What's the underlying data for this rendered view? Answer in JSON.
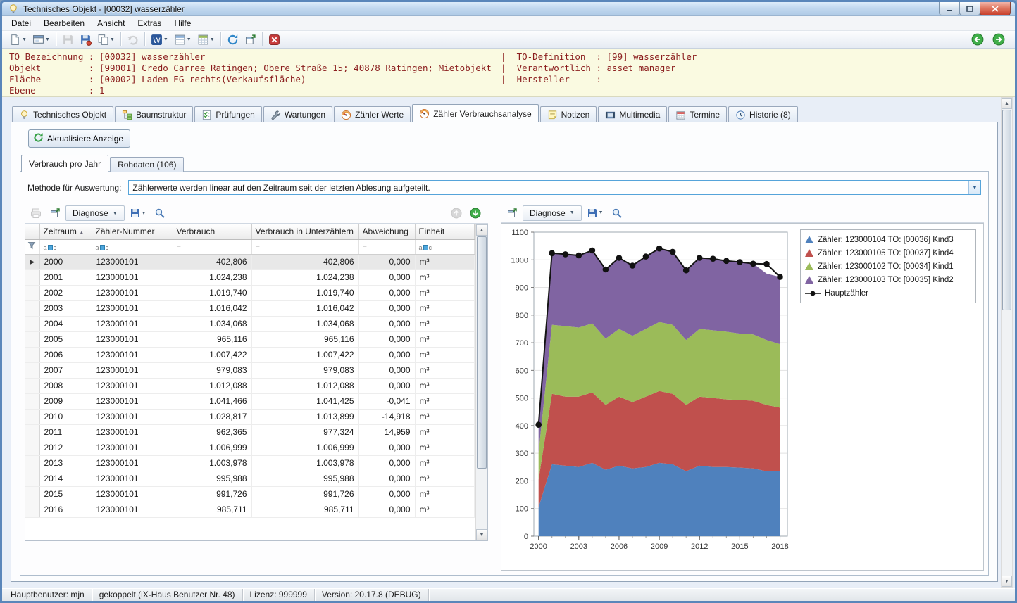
{
  "window": {
    "title": "Technisches Objekt - [00032] wasserzähler"
  },
  "menu": {
    "items": [
      "Datei",
      "Bearbeiten",
      "Ansicht",
      "Extras",
      "Hilfe"
    ]
  },
  "info_panel": {
    "lines": [
      {
        "left": "TO Bezeichnung : [00032] wasserzähler",
        "right": "|  TO-Definition  : [99] wasserzähler"
      },
      {
        "left": "Objekt         : [99001] Credo Carree Ratingen; Obere Straße 15; 40878 Ratingen; Mietobjekt",
        "right": "|  Verantwortlich : asset manager"
      },
      {
        "left": "Fläche         : [00002] Laden EG rechts(Verkaufsfläche)",
        "right": "|  Hersteller     :"
      },
      {
        "left": "Ebene          : 1",
        "right": ""
      }
    ]
  },
  "tabs": [
    {
      "label": "Technisches Objekt",
      "icon": "lightbulb",
      "active": false
    },
    {
      "label": "Baumstruktur",
      "icon": "tree",
      "active": false
    },
    {
      "label": "Prüfungen",
      "icon": "checklist",
      "active": false
    },
    {
      "label": "Wartungen",
      "icon": "wrench",
      "active": false
    },
    {
      "label": "Zähler Werte",
      "icon": "gauge",
      "active": false
    },
    {
      "label": "Zähler Verbrauchsanalyse",
      "icon": "gauge",
      "active": true
    },
    {
      "label": "Notizen",
      "icon": "note",
      "active": false
    },
    {
      "label": "Multimedia",
      "icon": "film",
      "active": false
    },
    {
      "label": "Termine",
      "icon": "calendar",
      "active": false
    },
    {
      "label": "Historie (8)",
      "icon": "clock",
      "active": false
    }
  ],
  "page": {
    "refresh_button": "Aktualisiere Anzeige",
    "subtabs": [
      {
        "label": "Verbrauch pro Jahr",
        "active": true
      },
      {
        "label": "Rohdaten (106)",
        "active": false
      }
    ],
    "method": {
      "label": "Methode für Auswertung:",
      "value": "Zählerwerte werden linear auf den Zeitraum seit der letzten Ablesung aufgeteilt."
    }
  },
  "table_panel": {
    "diagnose_label": "Diagnose",
    "table": {
      "columns": [
        {
          "label": "Zeitraum",
          "sort": "asc",
          "filter": "abc",
          "align": "left"
        },
        {
          "label": "Zähler-Nummer",
          "filter": "abc",
          "align": "left"
        },
        {
          "label": "Verbrauch",
          "filter": "eq",
          "align": "right"
        },
        {
          "label": "Verbrauch in Unterzählern",
          "filter": "eq",
          "align": "right"
        },
        {
          "label": "Abweichung",
          "filter": "eq",
          "align": "right"
        },
        {
          "label": "Einheit",
          "filter": "abc",
          "align": "left"
        }
      ],
      "rows": [
        [
          "2000",
          "123000101",
          "402,806",
          "402,806",
          "0,000",
          "m³"
        ],
        [
          "2001",
          "123000101",
          "1.024,238",
          "1.024,238",
          "0,000",
          "m³"
        ],
        [
          "2002",
          "123000101",
          "1.019,740",
          "1.019,740",
          "0,000",
          "m³"
        ],
        [
          "2003",
          "123000101",
          "1.016,042",
          "1.016,042",
          "0,000",
          "m³"
        ],
        [
          "2004",
          "123000101",
          "1.034,068",
          "1.034,068",
          "0,000",
          "m³"
        ],
        [
          "2005",
          "123000101",
          "965,116",
          "965,116",
          "0,000",
          "m³"
        ],
        [
          "2006",
          "123000101",
          "1.007,422",
          "1.007,422",
          "0,000",
          "m³"
        ],
        [
          "2007",
          "123000101",
          "979,083",
          "979,083",
          "0,000",
          "m³"
        ],
        [
          "2008",
          "123000101",
          "1.012,088",
          "1.012,088",
          "0,000",
          "m³"
        ],
        [
          "2009",
          "123000101",
          "1.041,466",
          "1.041,425",
          "-0,041",
          "m³"
        ],
        [
          "2010",
          "123000101",
          "1.028,817",
          "1.013,899",
          "-14,918",
          "m³"
        ],
        [
          "2011",
          "123000101",
          "962,365",
          "977,324",
          "14,959",
          "m³"
        ],
        [
          "2012",
          "123000101",
          "1.006,999",
          "1.006,999",
          "0,000",
          "m³"
        ],
        [
          "2013",
          "123000101",
          "1.003,978",
          "1.003,978",
          "0,000",
          "m³"
        ],
        [
          "2014",
          "123000101",
          "995,988",
          "995,988",
          "0,000",
          "m³"
        ],
        [
          "2015",
          "123000101",
          "991,726",
          "991,726",
          "0,000",
          "m³"
        ],
        [
          "2016",
          "123000101",
          "985,711",
          "985,711",
          "0,000",
          "m³"
        ]
      ]
    }
  },
  "chart_panel": {
    "diagnose_label": "Diagnose"
  },
  "chart_data": {
    "type": "area",
    "stacked": true,
    "x": [
      2000,
      2001,
      2002,
      2003,
      2004,
      2005,
      2006,
      2007,
      2008,
      2009,
      2010,
      2011,
      2012,
      2013,
      2014,
      2015,
      2016,
      2017,
      2018
    ],
    "series": [
      {
        "name": "Zähler: 123000104 TO: [00036] Kind3",
        "color": "#4F81BD",
        "values": [
          105,
          260,
          255,
          250,
          265,
          240,
          255,
          245,
          250,
          265,
          260,
          235,
          255,
          250,
          250,
          248,
          245,
          235,
          235
        ]
      },
      {
        "name": "Zähler: 123000105 TO: [00037] Kind4",
        "color": "#C0504D",
        "values": [
          100,
          255,
          250,
          255,
          255,
          235,
          250,
          240,
          255,
          260,
          255,
          240,
          250,
          250,
          245,
          245,
          245,
          240,
          230
        ]
      },
      {
        "name": "Zähler: 123000102 TO: [00034] Kind1",
        "color": "#9BBB59",
        "values": [
          98,
          250,
          255,
          250,
          250,
          240,
          245,
          240,
          245,
          250,
          250,
          235,
          245,
          245,
          245,
          240,
          240,
          235,
          230
        ]
      },
      {
        "name": "Zähler: 123000103 TO: [00035] Kind2",
        "color": "#8064A2",
        "values": [
          100,
          259,
          260,
          261,
          264,
          250,
          257,
          254,
          262,
          266,
          264,
          252,
          257,
          259,
          256,
          259,
          256,
          240,
          243
        ]
      }
    ],
    "line_series": {
      "name": "Hauptzähler",
      "color": "#000000",
      "values": [
        403,
        1024,
        1020,
        1016,
        1034,
        965,
        1007,
        979,
        1012,
        1041,
        1029,
        962,
        1007,
        1004,
        996,
        992,
        986,
        985,
        938
      ]
    },
    "ylim": [
      0,
      1100
    ],
    "ytick_step": 100,
    "xticks": [
      2000,
      2003,
      2006,
      2009,
      2012,
      2015,
      2018
    ],
    "grid": "horizontal",
    "legend_position": "top-right"
  },
  "status_bar": {
    "items": [
      "Hauptbenutzer: mjn",
      "gekoppelt (iX-Haus Benutzer Nr. 48)",
      "Lizenz: 999999",
      "Version: 20.17.8 (DEBUG)"
    ]
  }
}
